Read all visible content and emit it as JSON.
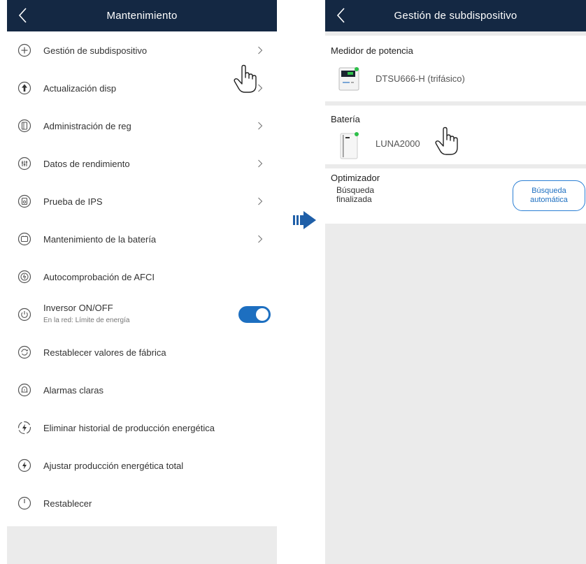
{
  "left_screen": {
    "header": {
      "title": "Mantenimiento",
      "back_icon": "chevron-left-icon"
    },
    "menu_items": [
      {
        "label": "Gestión de subdispositivo",
        "icon": "plus-circle-icon",
        "chevron": true
      },
      {
        "label": "Actualización disp",
        "icon": "upload-arrow-icon",
        "chevron": true
      },
      {
        "label": "Administración de reg",
        "icon": "log-icon",
        "chevron": true
      },
      {
        "label": "Datos de rendimiento",
        "icon": "sliders-icon",
        "chevron": true
      },
      {
        "label": "Prueba de IPS",
        "icon": "ips-test-icon",
        "chevron": true
      },
      {
        "label": "Mantenimiento de la batería",
        "icon": "battery-icon",
        "chevron": true
      },
      {
        "label": "Autocomprobación de AFCI",
        "icon": "afci-icon",
        "chevron": false
      },
      {
        "label": "Inversor ON/OFF",
        "sublabel": "En la red: Límite de energía",
        "icon": "power-icon",
        "toggle": true
      },
      {
        "label": "Restablecer valores de fábrica",
        "icon": "reset-factory-icon",
        "chevron": false
      },
      {
        "label": "Alarmas claras",
        "icon": "alarm-bell-icon",
        "chevron": false
      },
      {
        "label": "Eliminar historial de producción energética",
        "icon": "lightning-icon",
        "chevron": false
      },
      {
        "label": "Ajustar producción energética total",
        "icon": "lightning-adjust-icon",
        "chevron": false
      },
      {
        "label": "Restablecer",
        "icon": "power-reset-icon",
        "chevron": false
      }
    ]
  },
  "right_screen": {
    "header": {
      "title": "Gestión de subdispositivo",
      "back_icon": "chevron-left-icon"
    },
    "power_meter": {
      "title": "Medidor de potencia",
      "device": "DTSU666-H (trifásico)"
    },
    "battery": {
      "title": "Batería",
      "device": "LUNA2000"
    },
    "optimizer": {
      "title": "Optimizador",
      "status": "Búsqueda finalizada",
      "button": "Búsqueda automática"
    }
  },
  "colors": {
    "header_bg": "#142843",
    "accent": "#1d6fc0",
    "panel_bg": "#ebebeb",
    "status_green": "#2ec04a"
  }
}
